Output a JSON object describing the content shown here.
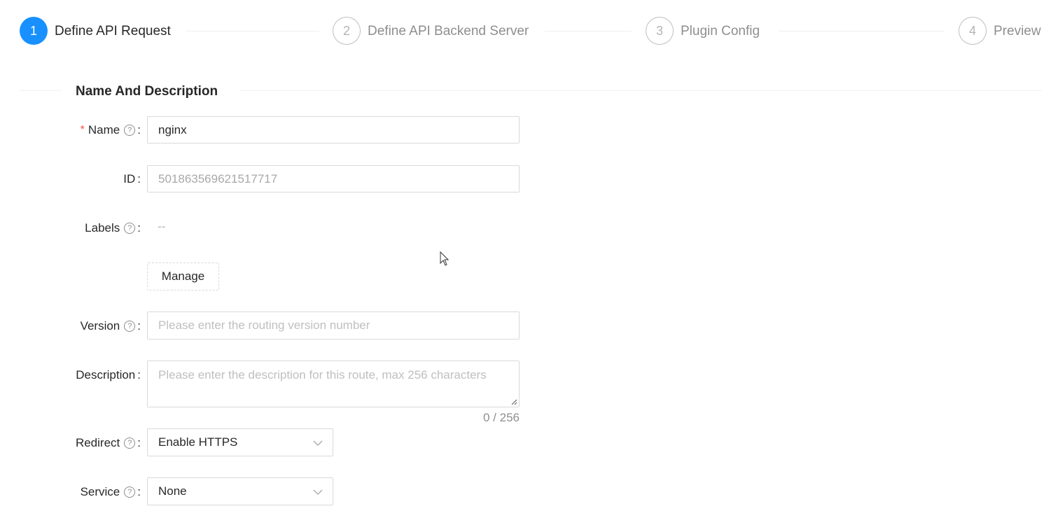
{
  "steps": [
    {
      "number": "1",
      "title": "Define API Request",
      "status": "active"
    },
    {
      "number": "2",
      "title": "Define API Backend Server",
      "status": "wait"
    },
    {
      "number": "3",
      "title": "Plugin Config",
      "status": "wait"
    },
    {
      "number": "4",
      "title": "Preview",
      "status": "wait"
    }
  ],
  "section": {
    "title": "Name And Description"
  },
  "form": {
    "name": {
      "label": "Name",
      "value": "nginx",
      "required_mark": "*"
    },
    "id": {
      "label": "ID",
      "value": "501863569621517717"
    },
    "labels": {
      "label": "Labels",
      "value": "--",
      "manage_button": "Manage"
    },
    "version": {
      "label": "Version",
      "placeholder": "Please enter the routing version number"
    },
    "description": {
      "label": "Description",
      "placeholder": "Please enter the description for this route, max 256 characters",
      "counter": "0 / 256"
    },
    "redirect": {
      "label": "Redirect",
      "value": "Enable HTTPS"
    },
    "service": {
      "label": "Service",
      "value": "None"
    }
  },
  "colors": {
    "primary": "#1890ff",
    "required": "#ff4d4f",
    "border": "#d9d9d9"
  },
  "icons": {
    "help": "question-circle-icon",
    "dropdown": "chevron-down-icon"
  }
}
